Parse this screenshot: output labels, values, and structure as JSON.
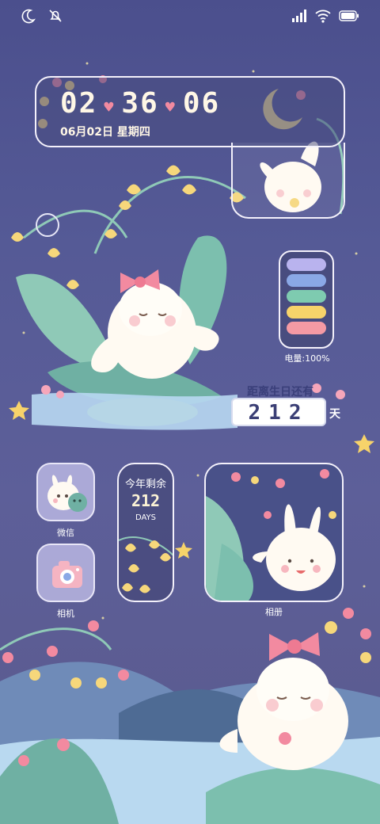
{
  "status_bar": {
    "left_icons": [
      "moon-icon",
      "notifications-muted-icon"
    ],
    "right_icons": [
      "signal-icon",
      "wifi-icon",
      "battery-icon"
    ]
  },
  "clock": {
    "time": "02❤ 36❤ 06",
    "hours": "02",
    "minutes": "36",
    "seconds": "06",
    "date": "06月02日 星期四"
  },
  "battery_widget": {
    "label": "电量:100%",
    "level_percent": 100,
    "bar_colors": [
      "#b9b3ee",
      "#8aa8e6",
      "#7ecbb0",
      "#f7d36a",
      "#f59aa4"
    ]
  },
  "birthday_countdown": {
    "title": "距离生日还有",
    "days": "212",
    "unit": "天"
  },
  "apps": [
    {
      "label": "微信",
      "icon": "wechat-bunny-icon"
    },
    {
      "label": "相机",
      "icon": "camera-icon"
    }
  ],
  "year_widget": {
    "title": "今年剩余",
    "days": "212",
    "unit": "DAYS"
  },
  "photo_widget": {
    "label": "相册",
    "icon": "gallery-bunny-icon"
  },
  "colors": {
    "background": "#4b4f8d",
    "frame": "#f4f1fb",
    "accent_pink": "#f28aa0",
    "accent_yellow": "#f7d36a",
    "accent_green": "#7ecbb0"
  }
}
